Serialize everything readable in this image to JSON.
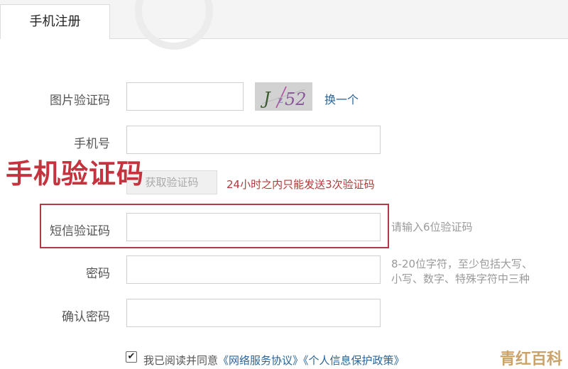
{
  "tab": {
    "label": "手机注册"
  },
  "form": {
    "captcha_label": "图片验证码",
    "captcha_value": "",
    "captcha_image_text": "J 52",
    "captcha_refresh": "换一个",
    "phone_label": "手机号",
    "phone_value": "",
    "get_code_button": "获取验证码",
    "send_limit_note": "24小时之内只能发送3次验证码",
    "sms_label": "短信验证码",
    "sms_value": "",
    "sms_hint": "请输入6位验证码",
    "password_label": "密码",
    "password_value": "",
    "password_hint_line1": "8-20位字符，至少包括大写、",
    "password_hint_line2": "小写、数字、特殊字符中三种",
    "confirm_label": "确认密码",
    "confirm_value": ""
  },
  "agreement": {
    "checked": true,
    "check_glyph": "✔",
    "prefix": "我已阅读并同意",
    "link_service": "《网络服务协议》",
    "link_privacy": "《个人信息保护政策》"
  },
  "annotation": {
    "text": "手机验证码",
    "color": "#c4343f"
  },
  "watermark": {
    "text": "青红百科"
  },
  "colors": {
    "link": "#2a6496",
    "warning": "#b03a3a",
    "hint": "#9a9a9a"
  }
}
